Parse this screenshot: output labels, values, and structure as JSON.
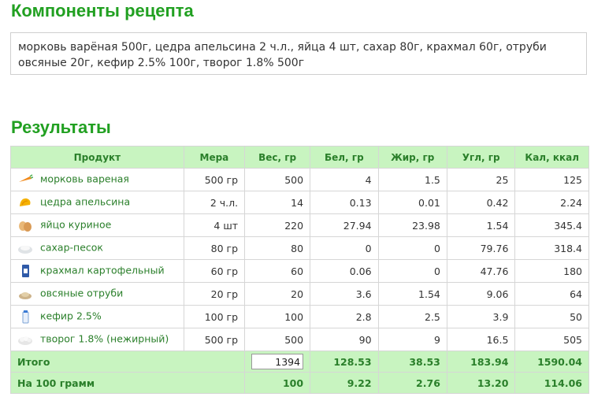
{
  "headings": {
    "components": "Компоненты рецепта",
    "results": "Результаты"
  },
  "recipe_text": "морковь варёная 500г, цедра апельсина 2 ч.л., яйца 4 шт, сахар 80г, крахмал 60г, отруби овсяные 20г, кефир 2.5% 100г, творог 1.8% 500г",
  "table": {
    "headers": [
      "Продукт",
      "Мера",
      "Вес, гр",
      "Бел, гр",
      "Жир, гр",
      "Угл, гр",
      "Кал, ккал"
    ],
    "rows": [
      {
        "icon": "carrot-icon",
        "name": "морковь вареная",
        "measure": "500 гр",
        "weight": "500",
        "protein": "4",
        "fat": "1.5",
        "carbs": "25",
        "kcal": "125"
      },
      {
        "icon": "orange-zest-icon",
        "name": "цедра апельсина",
        "measure": "2 ч.л.",
        "weight": "14",
        "protein": "0.13",
        "fat": "0.01",
        "carbs": "0.42",
        "kcal": "2.24"
      },
      {
        "icon": "eggs-icon",
        "name": "яйцо куриное",
        "measure": "4 шт",
        "weight": "220",
        "protein": "27.94",
        "fat": "23.98",
        "carbs": "1.54",
        "kcal": "345.4"
      },
      {
        "icon": "sugar-icon",
        "name": "сахар-песок",
        "measure": "80 гр",
        "weight": "80",
        "protein": "0",
        "fat": "0",
        "carbs": "79.76",
        "kcal": "318.4"
      },
      {
        "icon": "starch-icon",
        "name": "крахмал картофельный",
        "measure": "60 гр",
        "weight": "60",
        "protein": "0.06",
        "fat": "0",
        "carbs": "47.76",
        "kcal": "180"
      },
      {
        "icon": "oat-bran-icon",
        "name": "овсяные отруби",
        "measure": "20 гр",
        "weight": "20",
        "protein": "3.6",
        "fat": "1.54",
        "carbs": "9.06",
        "kcal": "64"
      },
      {
        "icon": "kefir-icon",
        "name": "кефир 2.5%",
        "measure": "100 гр",
        "weight": "100",
        "protein": "2.8",
        "fat": "2.5",
        "carbs": "3.9",
        "kcal": "50"
      },
      {
        "icon": "cottage-cheese-icon",
        "name": "творог 1.8% (нежирный)",
        "measure": "500 гр",
        "weight": "500",
        "protein": "90",
        "fat": "9",
        "carbs": "16.5",
        "kcal": "505"
      }
    ],
    "total": {
      "label": "Итого",
      "weight": "1394",
      "protein": "128.53",
      "fat": "38.53",
      "carbs": "183.94",
      "kcal": "1590.04"
    },
    "per100": {
      "label": "На 100 грамм",
      "weight": "100",
      "protein": "9.22",
      "fat": "2.76",
      "carbs": "13.20",
      "kcal": "114.06"
    }
  }
}
